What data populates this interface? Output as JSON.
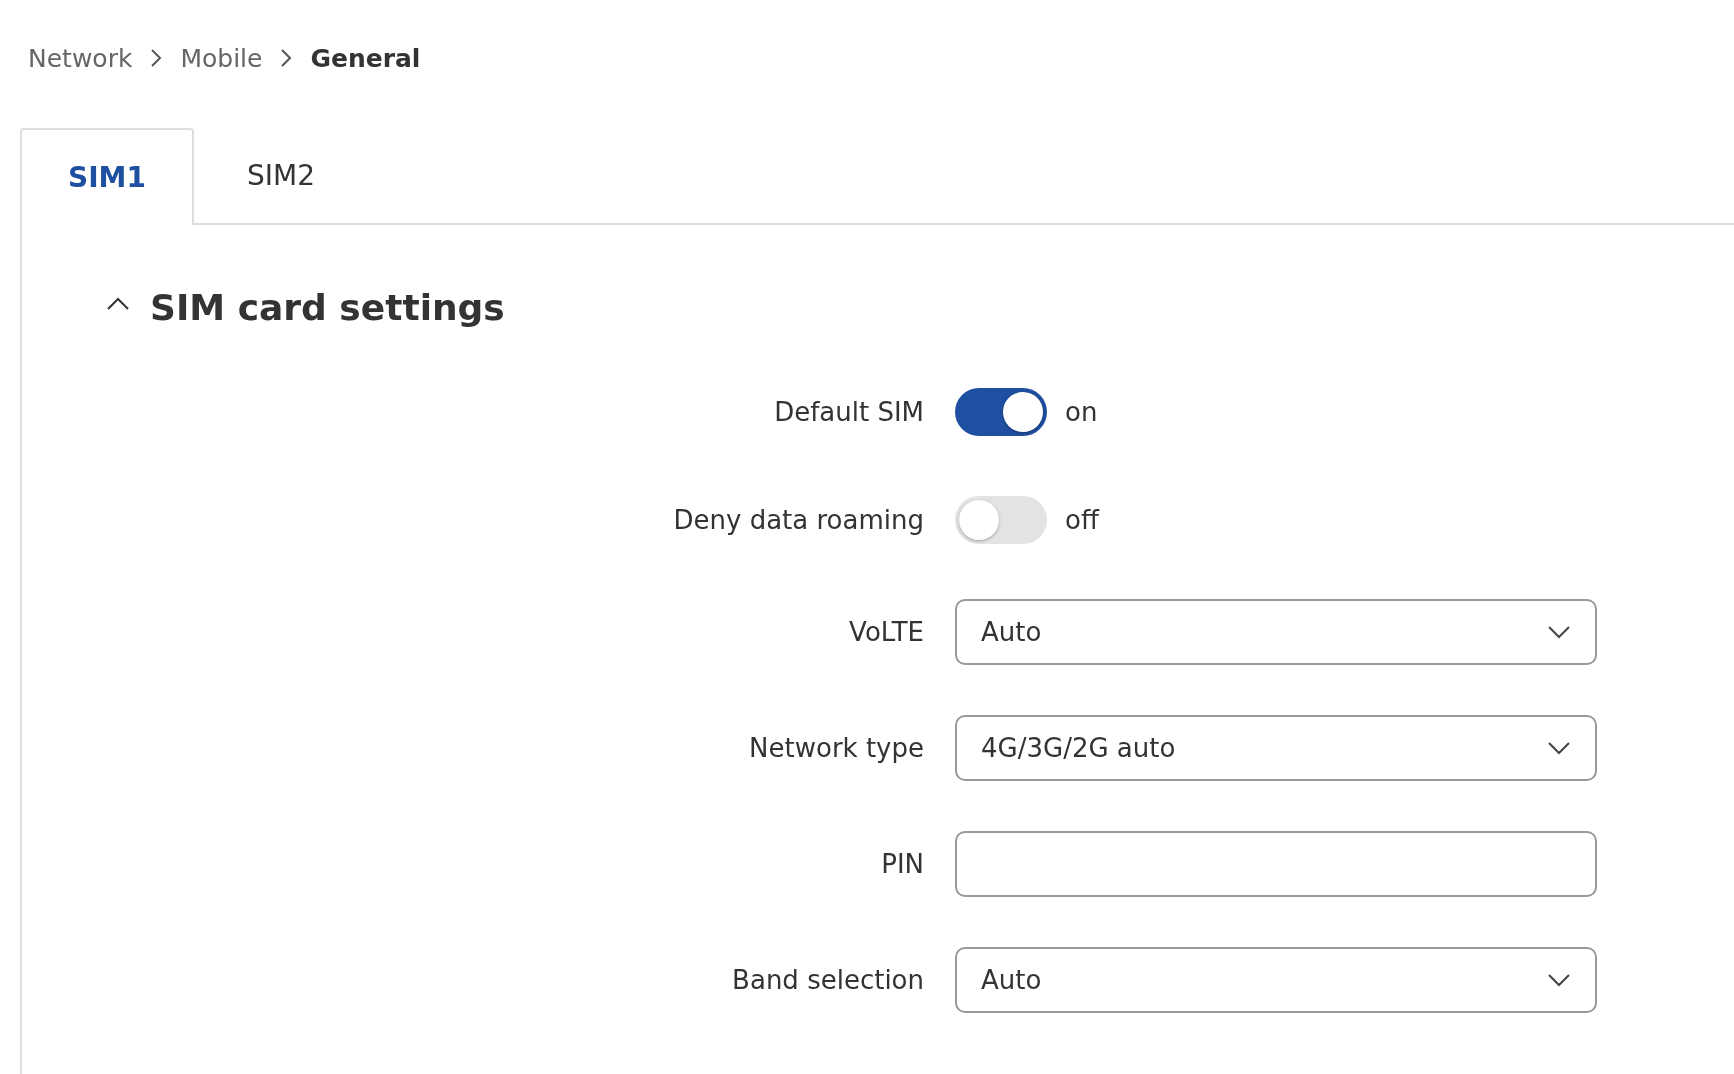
{
  "breadcrumb": [
    {
      "label": "Network",
      "current": false
    },
    {
      "label": "Mobile",
      "current": false
    },
    {
      "label": "General",
      "current": true
    }
  ],
  "tabs": [
    {
      "label": "SIM1",
      "selected": true
    },
    {
      "label": "SIM2",
      "selected": false
    }
  ],
  "section": {
    "title": "SIM card settings",
    "expanded": true
  },
  "fields": [
    {
      "kind": "toggle",
      "label": "Default SIM",
      "on": true,
      "state_text": "on"
    },
    {
      "kind": "toggle",
      "label": "Deny data roaming",
      "on": false,
      "state_text": "off"
    },
    {
      "kind": "select",
      "label": "VoLTE",
      "value": "Auto"
    },
    {
      "kind": "select",
      "label": "Network type",
      "value": "4G/3G/2G auto"
    },
    {
      "kind": "text",
      "label": "PIN"
    },
    {
      "kind": "select",
      "label": "Band selection",
      "value": "Auto"
    }
  ]
}
